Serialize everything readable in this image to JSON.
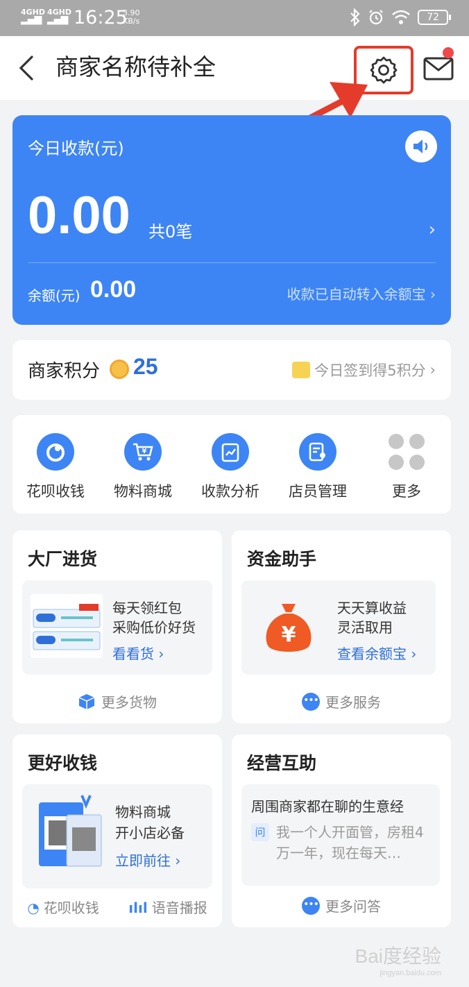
{
  "status_bar": {
    "signal1": "4GHD",
    "signal2": "4GHD",
    "time": "16:25",
    "speed_value": "3.90",
    "speed_unit": "KB/s",
    "battery": "72"
  },
  "header": {
    "title": "商家名称待补全"
  },
  "income_card": {
    "label": "今日收款(元)",
    "amount": "0.00",
    "count": "共0笔",
    "balance_label": "余额(元)",
    "balance_value": "0.00",
    "auto_note": "收款已自动转入余额宝"
  },
  "points": {
    "label": "商家积分",
    "value": "25",
    "signin": "今日签到得5积分"
  },
  "quick_actions": [
    {
      "label": "花呗收钱",
      "icon": "huabei-icon"
    },
    {
      "label": "物料商城",
      "icon": "cart-icon"
    },
    {
      "label": "收款分析",
      "icon": "chart-icon"
    },
    {
      "label": "店员管理",
      "icon": "staff-icon"
    },
    {
      "label": "更多",
      "icon": "more-grid-icon"
    }
  ],
  "features": {
    "wholesale": {
      "title": "大厂进货",
      "line1": "每天领红包",
      "line2": "采购低价好货",
      "link": "看看货",
      "more": "更多货物"
    },
    "finance": {
      "title": "资金助手",
      "line1": "天天算收益",
      "line2": "灵活取用",
      "link": "查看余额宝",
      "more": "更多服务"
    },
    "collect": {
      "title": "更好收钱",
      "line1": "物料商城",
      "line2": "开小店必备",
      "link": "立即前往",
      "bottom_left": "花呗收钱",
      "bottom_right": "语音播报"
    },
    "mutual": {
      "title": "经营互助",
      "head": "周围商家都在聊的生意经",
      "badge": "问",
      "question": "我一个人开面管，房租4万一年，现在每天…",
      "more": "更多问答"
    }
  },
  "watermark": {
    "brand": "Bai度经验",
    "url": "jingyan.baidu.com"
  },
  "colors": {
    "primary_blue": "#3d85f4",
    "highlight_red": "#e53b2a",
    "link_blue": "#2f6fd8"
  }
}
